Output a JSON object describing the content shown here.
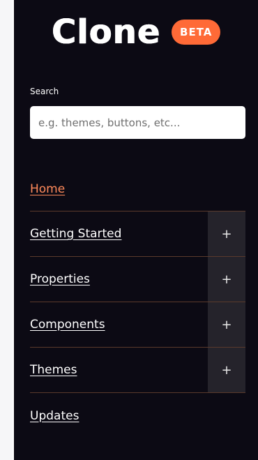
{
  "brand": {
    "logo_text": "Clone",
    "badge": "BETA",
    "badge_color": "#ff6a37"
  },
  "search": {
    "label": "Search",
    "placeholder": "e.g. themes, buttons, etc..."
  },
  "nav": {
    "home": "Home",
    "items": [
      {
        "label": "Getting Started",
        "toggle": "+"
      },
      {
        "label": "Properties",
        "toggle": "+"
      },
      {
        "label": "Components",
        "toggle": "+"
      },
      {
        "label": "Themes",
        "toggle": "+"
      }
    ],
    "updates": "Updates"
  },
  "colors": {
    "panel_bg": "#0c0a14",
    "accent": "#ff8a5b",
    "divider": "#5b3a2c",
    "toggle_bg": "#25232b"
  }
}
